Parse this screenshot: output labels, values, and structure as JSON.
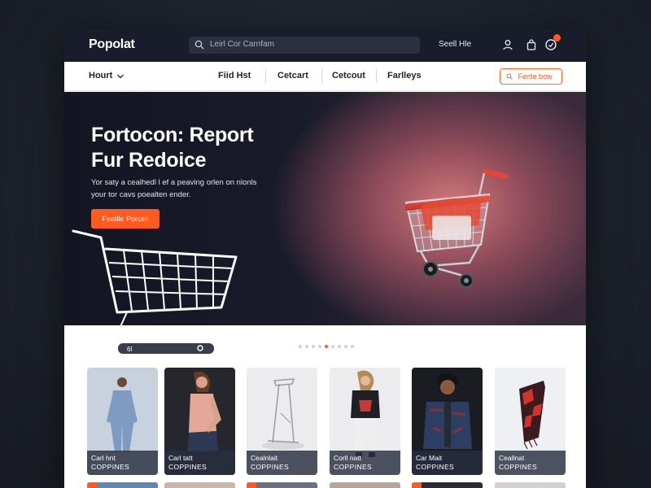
{
  "header": {
    "logo": "Popolat",
    "search_placeholder": "Leirl Cor Carnfam",
    "sell_link": "Seell Hle",
    "icons": [
      "user-icon",
      "bag-icon",
      "cart-icon"
    ],
    "cart_badge_color": "#ff5a1f",
    "background": "#191c2b"
  },
  "nav": {
    "home_label": "Hourt",
    "links": [
      {
        "label": "Fiid Hst"
      },
      {
        "label": "Cetcart"
      },
      {
        "label": "Cetcout"
      },
      {
        "label": "Farlleys"
      }
    ],
    "cta_label": "Fertle bow"
  },
  "hero": {
    "title_line1": "Fortocon: Report",
    "title_line2": "Fur Redoice",
    "body_line1": "Yor saty a cealhedl l ef a peaving orlen on nlonls",
    "body_line2": "your tor cavs poealten ender.",
    "button_label": "Featlle Porcell",
    "outline_cart_tag": "6l",
    "accent": "#ff5a1f"
  },
  "carousel": {
    "dot_count": 9,
    "active_index": 4
  },
  "products": [
    {
      "title": "Carl hnt",
      "subtitle": "COPPINES",
      "figure": "denim-jumpsuit-person"
    },
    {
      "title": "Carl tatt",
      "subtitle": "COPPINES",
      "figure": "pink-top-person"
    },
    {
      "title": "Cealnlait",
      "subtitle": "COPPINES",
      "figure": "metal-stand"
    },
    {
      "title": "Corll natt",
      "subtitle": "COPPINES",
      "figure": "black-sweater-person"
    },
    {
      "title": "Car Mait",
      "subtitle": "COPPINES",
      "figure": "denim-jacket-person"
    },
    {
      "title": "Ceallnat",
      "subtitle": "COPPINES",
      "figure": "red-black-scarf"
    }
  ]
}
